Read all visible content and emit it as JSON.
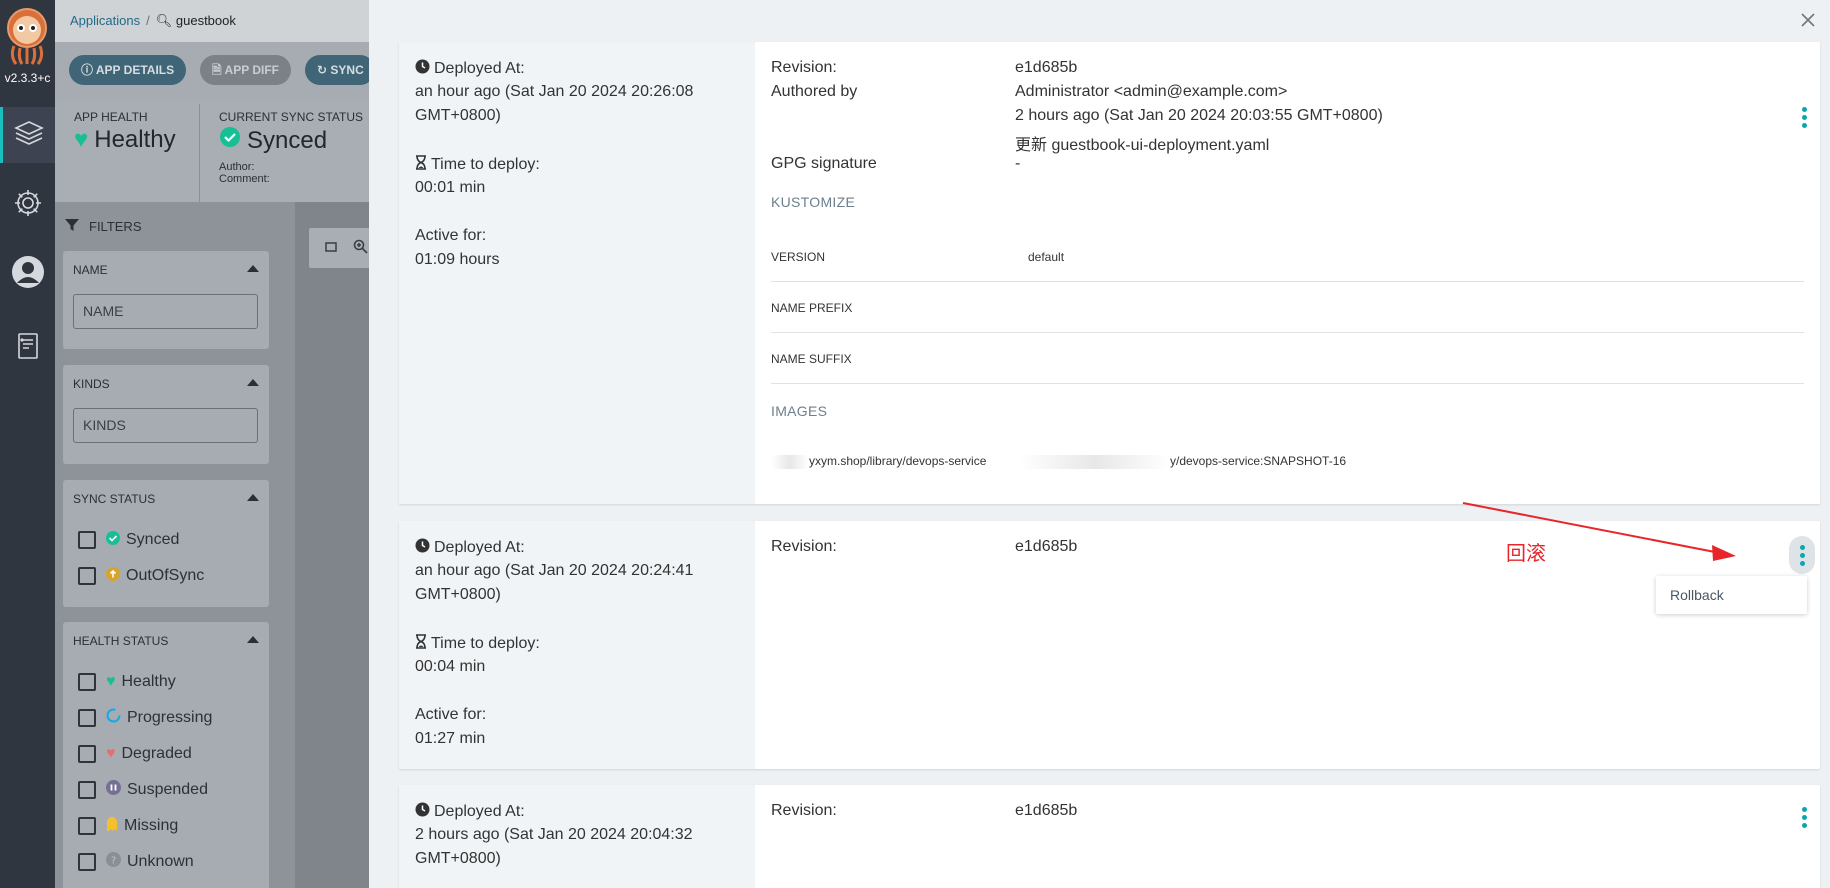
{
  "nav": {
    "version": "v2.3.3+c",
    "items": [
      "applications-icon",
      "settings-icon",
      "user-icon",
      "docs-icon"
    ]
  },
  "breadcrumb": {
    "root": "Applications",
    "current": "guestbook"
  },
  "toolbar": {
    "app_details": "APP DETAILS",
    "app_diff": "APP DIFF",
    "sync": "SYNC"
  },
  "status": {
    "app_health_label": "APP HEALTH",
    "app_health_value": "Healthy",
    "sync_status_label": "CURRENT SYNC STATUS",
    "sync_status_value": "Synced",
    "author_label": "Author:",
    "comment_label": "Comment:"
  },
  "filters": {
    "header": "FILTERS",
    "name": {
      "title": "NAME",
      "placeholder": "NAME"
    },
    "kinds": {
      "title": "KINDS",
      "placeholder": "KINDS"
    },
    "sync_status": {
      "title": "SYNC STATUS",
      "options": [
        "Synced",
        "OutOfSync"
      ]
    },
    "health_status": {
      "title": "HEALTH STATUS",
      "options": [
        "Healthy",
        "Progressing",
        "Degraded",
        "Suspended",
        "Missing",
        "Unknown"
      ]
    }
  },
  "colors": {
    "accent": "#0aa6b0",
    "healthy": "#18be94",
    "annotation": "#e8262a"
  },
  "history": [
    {
      "deployed_at_label": "Deployed At:",
      "deployed_at_line1": "an hour ago (Sat Jan 20 2024 20:26:08",
      "deployed_at_line2": "GMT+0800)",
      "time_to_deploy_label": "Time to deploy:",
      "time_to_deploy": "00:01 min",
      "active_for_label": "Active for:",
      "active_for": "01:09 hours",
      "revision_label": "Revision:",
      "revision": "e1d685b",
      "authored_by_label": "Authored by",
      "author": "Administrator <admin@example.com>",
      "authored_date": "2 hours ago (Sat Jan 20 2024 20:03:55 GMT+0800)",
      "commit_message": "更新 guestbook-ui-deployment.yaml",
      "gpg_label": "GPG signature",
      "gpg_value": "-",
      "kustomize_label": "KUSTOMIZE",
      "kustomize_rows": [
        {
          "key": "VERSION",
          "value": "default"
        },
        {
          "key": "NAME PREFIX",
          "value": ""
        },
        {
          "key": "NAME SUFFIX",
          "value": ""
        }
      ],
      "images_label": "IMAGES",
      "image_name": "yxym.shop/library/devops-service",
      "image_tag": "y/devops-service:SNAPSHOT-16"
    },
    {
      "deployed_at_label": "Deployed At:",
      "deployed_at_line1": "an hour ago (Sat Jan 20 2024 20:24:41",
      "deployed_at_line2": "GMT+0800)",
      "time_to_deploy_label": "Time to deploy:",
      "time_to_deploy": "00:04 min",
      "active_for_label": "Active for:",
      "active_for": "01:27 min",
      "revision_label": "Revision:",
      "revision": "e1d685b",
      "menu_item": "Rollback"
    },
    {
      "deployed_at_label": "Deployed At:",
      "deployed_at_line1": "2 hours ago (Sat Jan 20 2024 20:04:32",
      "deployed_at_line2": "GMT+0800)",
      "revision_label": "Revision:",
      "revision": "e1d685b"
    }
  ],
  "annotation": {
    "text": "回滚"
  }
}
